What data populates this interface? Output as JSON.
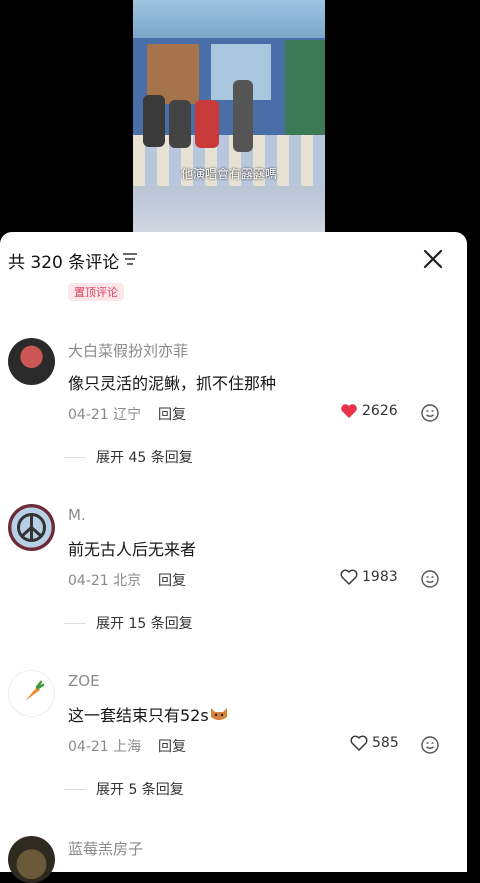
{
  "video": {
    "subtitle": "他演唱會有露露嗎"
  },
  "sheet": {
    "title": "共 320 条评论",
    "pinned_label": "置顶评论"
  },
  "comments": [
    {
      "username": "大白菜假扮刘亦菲",
      "text": "像只灵活的泥鳅，抓不住那种",
      "date_loc": "04-21 辽宁",
      "reply": "回复",
      "likes": "2626",
      "liked": true,
      "expand": "展开 45 条回复"
    },
    {
      "username": "M.",
      "text": "前无古人后无来者",
      "date_loc": "04-21 北京",
      "reply": "回复",
      "likes": "1983",
      "liked": false,
      "expand": "展开 15 条回复"
    },
    {
      "username": "ZOE",
      "text": "这一套结束只有52s",
      "date_loc": "04-21 上海",
      "reply": "回复",
      "likes": "585",
      "liked": false,
      "expand": "展开 5 条回复"
    },
    {
      "username": "蓝莓羔房子"
    }
  ],
  "icons": {
    "filter": "filter-icon",
    "close": "close-icon",
    "heart": "heart-icon",
    "emoji": "emoji-icon"
  },
  "colors": {
    "liked": "#e8334a",
    "badge_text": "#e0445c",
    "badge_bg": "#fde6ea"
  }
}
